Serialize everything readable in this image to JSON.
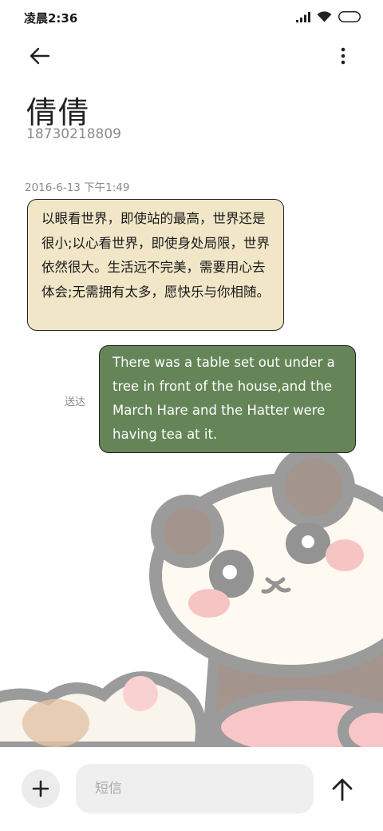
{
  "status_bar": {
    "time": "凌晨2:36",
    "icons": [
      "signal-icon",
      "wifi-icon",
      "battery-icon"
    ]
  },
  "header": {
    "back_icon": "arrow-left-icon",
    "more_icon": "more-vertical-icon"
  },
  "contact": {
    "name": "倩倩",
    "number": "18730218809"
  },
  "conversation": {
    "timestamp": "2016-6-13 下午1:49",
    "incoming": {
      "text": "以眼看世界，即使站的最高，世界还是很小;以心看世界，即使身处局限，世界依然很大。生活远不完美，需要用心去体会;无需拥有太多，愿快乐与你相随。"
    },
    "outgoing": {
      "text": "There was a table set out under a tree in front of the house,and the March Hare and the Hatter were having tea at it.",
      "status": "送达"
    }
  },
  "input_bar": {
    "add_icon": "plus-icon",
    "placeholder": "短信",
    "send_icon": "send-arrow-up-icon"
  },
  "colors": {
    "incoming_bubble": "#f1e6c8",
    "outgoing_bubble": "#658558",
    "background": "#ffffff"
  }
}
